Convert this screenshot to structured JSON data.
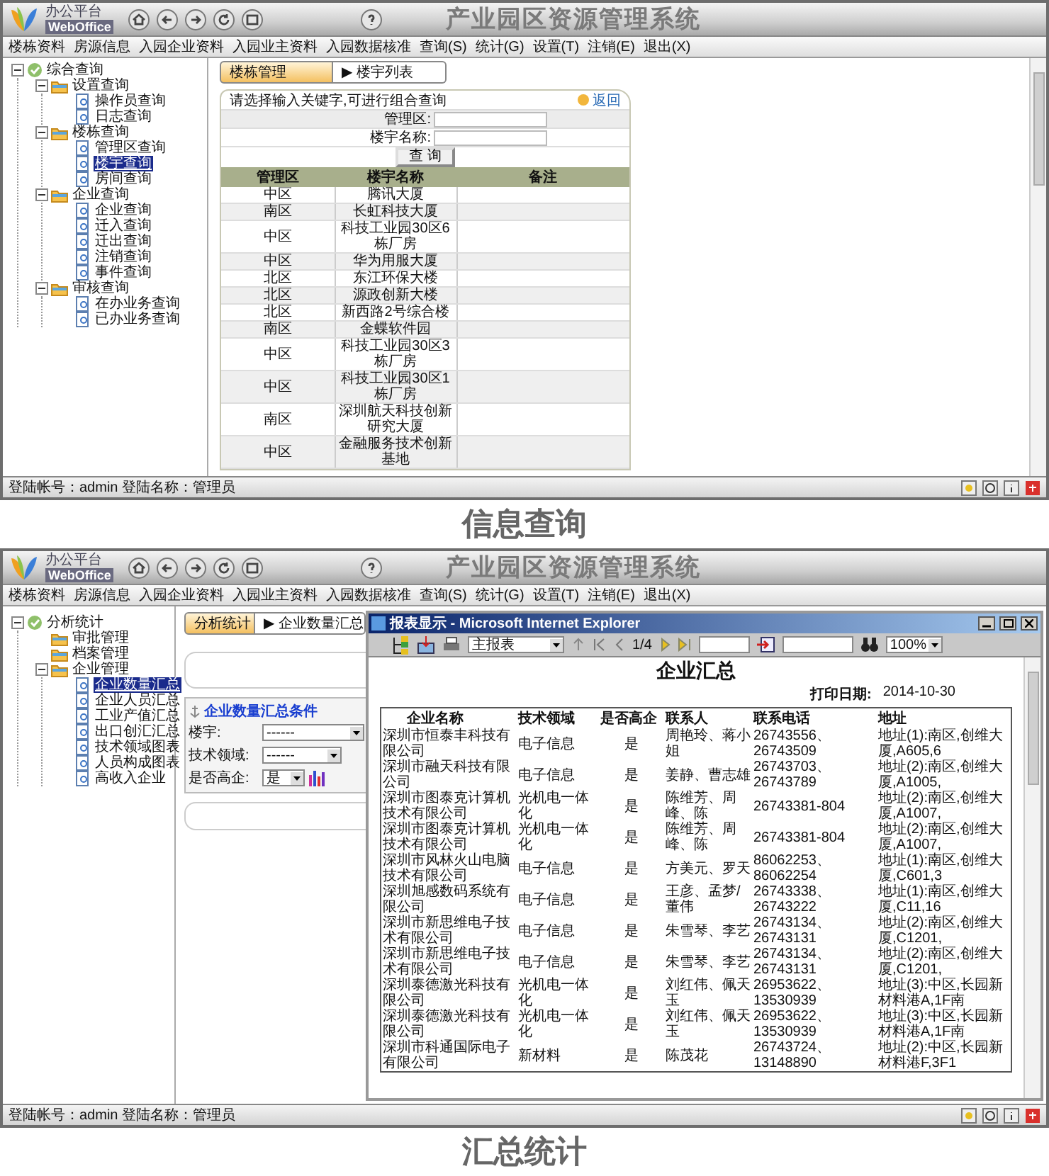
{
  "screens": [
    {
      "kind": "query",
      "logo": {
        "title": "办公平台",
        "subtitle": "WebOffice"
      },
      "title": "产业园区资源管理系统",
      "menu": [
        "楼栋资料",
        "房源信息",
        "入园企业资料",
        "入园业主资料",
        "入园数据核准",
        "查询(S)",
        "统计(G)",
        "设置(T)",
        "注销(E)",
        "退出(X)"
      ],
      "tree": [
        {
          "label": "综合查询",
          "expanded": true,
          "selected": false,
          "children": [
            {
              "label": "设置查询",
              "expanded": true,
              "selected": false,
              "children": [
                {
                  "label": "操作员查询",
                  "selected": false
                },
                {
                  "label": "日志查询",
                  "selected": false
                }
              ]
            },
            {
              "label": "楼栋查询",
              "expanded": true,
              "selected": false,
              "children": [
                {
                  "label": "管理区查询",
                  "selected": false
                },
                {
                  "label": "楼宇查询",
                  "selected": true
                },
                {
                  "label": "房间查询",
                  "selected": false
                }
              ]
            },
            {
              "label": "企业查询",
              "expanded": true,
              "selected": false,
              "children": [
                {
                  "label": "企业查询",
                  "selected": false
                },
                {
                  "label": "迁入查询",
                  "selected": false
                },
                {
                  "label": "迁出查询",
                  "selected": false
                },
                {
                  "label": "注销查询",
                  "selected": false
                },
                {
                  "label": "事件查询",
                  "selected": false
                }
              ]
            },
            {
              "label": "审核查询",
              "expanded": true,
              "selected": false,
              "children": [
                {
                  "label": "在办业务查询",
                  "selected": false
                },
                {
                  "label": "已办业务查询",
                  "selected": false
                }
              ]
            }
          ]
        }
      ],
      "tabs": [
        {
          "label": "楼栋管理",
          "selected": true
        },
        {
          "label": "▶ 楼宇列表",
          "selected": false
        }
      ],
      "prompt": "请选择输入关键字,可进行组合查询",
      "back_link": "返回",
      "fields": [
        {
          "label": "管理区:"
        },
        {
          "label": "楼宇名称:"
        }
      ],
      "button": "查 询",
      "table": {
        "columns": [
          "管理区",
          "楼宇名称",
          "备注"
        ],
        "rows": [
          {
            "zone": "中区",
            "building": "腾讯大厦"
          },
          {
            "zone": "南区",
            "building": "长虹科技大厦"
          },
          {
            "zone": "中区",
            "building": "科技工业园30区6栋厂房"
          },
          {
            "zone": "中区",
            "building": "华为用服大厦"
          },
          {
            "zone": "北区",
            "building": "东江环保大楼"
          },
          {
            "zone": "北区",
            "building": "源政创新大楼"
          },
          {
            "zone": "北区",
            "building": "新西路2号综合楼"
          },
          {
            "zone": "南区",
            "building": "金蝶软件园"
          },
          {
            "zone": "中区",
            "building": "科技工业园30区3栋厂房"
          },
          {
            "zone": "中区",
            "building": "科技工业园30区1栋厂房"
          },
          {
            "zone": "南区",
            "building": "深圳航天科技创新研究大厦"
          },
          {
            "zone": "中区",
            "building": "金融服务技术创新基地"
          }
        ]
      },
      "status": "登陆帐号：admin 登陆名称：管理员",
      "caption": "信息查询"
    },
    {
      "kind": "report",
      "logo": {
        "title": "办公平台",
        "subtitle": "WebOffice"
      },
      "title": "产业园区资源管理系统",
      "menu": [
        "楼栋资料",
        "房源信息",
        "入园企业资料",
        "入园业主资料",
        "入园数据核准",
        "查询(S)",
        "统计(G)",
        "设置(T)",
        "注销(E)",
        "退出(X)"
      ],
      "tree": [
        {
          "label": "分析统计",
          "expanded": true,
          "selected": false,
          "children": [
            {
              "label": "审批管理",
              "selected": false
            },
            {
              "label": "档案管理",
              "selected": false
            },
            {
              "label": "企业管理",
              "expanded": true,
              "selected": false,
              "children": [
                {
                  "label": "企业数量汇总",
                  "selected": true
                },
                {
                  "label": "企业人员汇总",
                  "selected": false
                },
                {
                  "label": "工业产值汇总",
                  "selected": false
                },
                {
                  "label": "出口创汇汇总",
                  "selected": false
                },
                {
                  "label": "技术领域图表",
                  "selected": false
                },
                {
                  "label": "人员构成图表",
                  "selected": false
                },
                {
                  "label": "高收入企业",
                  "selected": false
                }
              ]
            }
          ]
        }
      ],
      "tabs": [
        {
          "label": "分析统计",
          "selected": true
        },
        {
          "label": "▶ 企业数量汇总",
          "selected": false
        }
      ],
      "conditions": {
        "legend": "企业数量汇总条件",
        "fields": [
          {
            "label": "楼宇:",
            "value": "------"
          },
          {
            "label": "技术领域:",
            "value": "------"
          },
          {
            "label": "是否高企:",
            "value": "是"
          }
        ]
      },
      "report": {
        "window_title": "报表显示 - Microsoft Internet Explorer",
        "sheet": "主报表",
        "page": "1/4",
        "zoom": "100%",
        "heading": "企业汇总",
        "date_label": "打印日期:",
        "date": "2014-10-30",
        "columns": [
          "企业名称",
          "技术领域",
          "是否高企",
          "联系人",
          "联系电话",
          "地址"
        ],
        "rows": [
          [
            "深圳市恒泰丰科技有限公司",
            "电子信息",
            "是",
            "周艳玲、蒋小姐",
            "26743556、26743509",
            "地址(1):南区,创维大厦,A605,6"
          ],
          [
            "深圳市融天科技有限公司",
            "电子信息",
            "是",
            "姜静、曹志雄",
            "26743703、26743789",
            "地址(2):南区,创维大厦,A1005,"
          ],
          [
            "深圳市图泰克计算机技术有限公司",
            "光机电一体化",
            "是",
            "陈维芳、周峰、陈",
            "26743381-804",
            "地址(2):南区,创维大厦,A1007,"
          ],
          [
            "深圳市图泰克计算机技术有限公司",
            "光机电一体化",
            "是",
            "陈维芳、周峰、陈",
            "26743381-804",
            "地址(2):南区,创维大厦,A1007,"
          ],
          [
            "深圳市风林火山电脑技术有限公司",
            "电子信息",
            "是",
            "方美元、罗天",
            "86062253、86062254",
            "地址(1):南区,创维大厦,C601,3"
          ],
          [
            "深圳旭感数码系统有限公司",
            "电子信息",
            "是",
            "王彦、孟梦/董伟",
            "26743338、26743222",
            "地址(1):南区,创维大厦,C11,16"
          ],
          [
            "深圳市新思维电子技术有限公司",
            "电子信息",
            "是",
            "朱雪琴、李艺",
            "26743134、26743131",
            "地址(2):南区,创维大厦,C1201,"
          ],
          [
            "深圳市新思维电子技术有限公司",
            "电子信息",
            "是",
            "朱雪琴、李艺",
            "26743134、26743131",
            "地址(2):南区,创维大厦,C1201,"
          ],
          [
            "深圳泰德激光科技有限公司",
            "光机电一体化",
            "是",
            "刘红伟、佩天玉",
            "26953622、13530939",
            "地址(3):中区,长园新材料港A,1F南"
          ],
          [
            "深圳泰德激光科技有限公司",
            "光机电一体化",
            "是",
            "刘红伟、佩天玉",
            "26953622、13530939",
            "地址(3):中区,长园新材料港A,1F南"
          ],
          [
            "深圳市科通国际电子有限公司",
            "新材料",
            "是",
            "陈茂花",
            "26743724、13148890",
            "地址(2):中区,长园新材料港F,3F1"
          ]
        ]
      },
      "status": "登陆帐号：admin 登陆名称：管理员",
      "caption": "汇总统计"
    }
  ]
}
